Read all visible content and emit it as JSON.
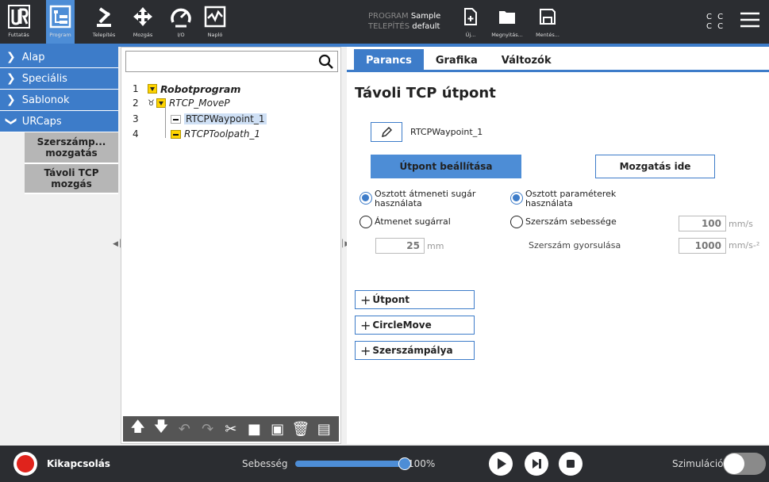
{
  "topbar": {
    "nav": [
      {
        "icon": "ur-logo-icon",
        "label": "Futtatás"
      },
      {
        "icon": "program-tree-icon",
        "label": "Program"
      },
      {
        "icon": "robot-arm-icon",
        "label": "Telepítés"
      },
      {
        "icon": "move-arrows-icon",
        "label": "Mozgás"
      },
      {
        "icon": "io-gauge-icon",
        "label": "I/O"
      },
      {
        "icon": "log-chart-icon",
        "label": "Napló"
      }
    ],
    "program_label": "PROGRAM",
    "program_value": "Sample",
    "installation_label": "TELEPÍTÉS",
    "installation_value": "default",
    "file_buttons": [
      {
        "icon": "new-file-icon",
        "label": "Új..."
      },
      {
        "icon": "open-folder-icon",
        "label": "Megnyitás..."
      },
      {
        "icon": "save-icon",
        "label": "Mentés..."
      }
    ],
    "cc_row1": "C C",
    "cc_row2": "C C",
    "colors": {
      "bar": "#2b2d31",
      "accent": "#3d7cc9"
    }
  },
  "leftnav": {
    "items": [
      {
        "label": "Alap",
        "icon": "chevron-right-icon"
      },
      {
        "label": "Speciális",
        "icon": "chevron-right-icon"
      },
      {
        "label": "Sablonok",
        "icon": "chevron-right-icon"
      },
      {
        "label": "URCaps",
        "icon": "chevron-down-icon"
      }
    ],
    "sub_items": [
      "Szerszámp... mozgatás",
      "Távoli TCP mozgás"
    ]
  },
  "tree": {
    "rows": [
      {
        "num": "1",
        "label": "Robotprogram"
      },
      {
        "num": "2",
        "label": "RTCP_MoveP"
      },
      {
        "num": "3",
        "label": "RTCPWaypoint_1"
      },
      {
        "num": "4",
        "label": "RTCPToolpath_1"
      }
    ]
  },
  "tabs": [
    "Parancs",
    "Grafika",
    "Változók"
  ],
  "panel": {
    "title": "Távoli TCP útpont",
    "waypoint_name": "RTCPWaypoint_1",
    "set_button": "Útpont beállítása",
    "move_button": "Mozgatás ide",
    "radio_shared_blend": "Osztott átmeneti sugár használata",
    "radio_blend": "Átmenet sugárral",
    "blend_value": "25",
    "blend_unit": "mm",
    "radio_shared_params": "Osztott paraméterek használata",
    "radio_tool_speed": "Szerszám sebessége",
    "tool_speed_value": "100",
    "tool_speed_unit": "mm/s",
    "tool_accel_label": "Szerszám gyorsulása",
    "tool_accel_value": "1000",
    "tool_accel_unit": "mm/s-²",
    "add_buttons": [
      "Útpont",
      "CircleMove",
      "Szerszámpálya"
    ]
  },
  "bottombar": {
    "power_label": "Kikapcsolás",
    "speed_label": "Sebesség",
    "speed_value": "100%",
    "speed_fraction": 1.0,
    "sim_label": "Szimuláció"
  }
}
